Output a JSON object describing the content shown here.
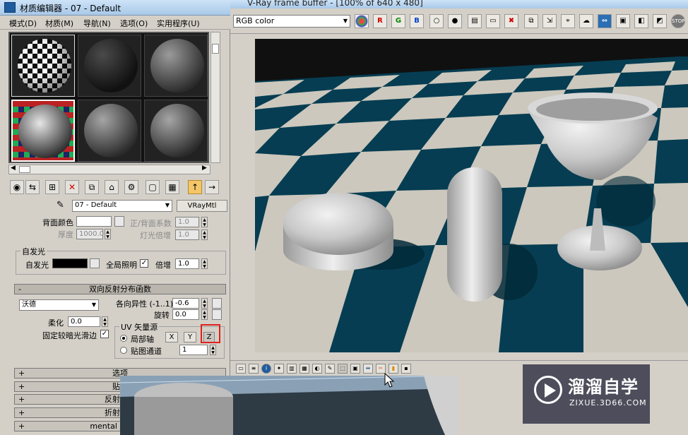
{
  "material_editor": {
    "title": "材质编辑器 - 07 - Default",
    "menu": [
      "模式(D)",
      "材质(M)",
      "导航(N)",
      "选项(O)",
      "实用程序(U)"
    ],
    "material_name": "07 - Default",
    "material_type": "VRayMtl",
    "back_color_label": "背面颜色",
    "front_back_coef_label": "正/背面系数",
    "front_back_coef": "1.0",
    "thickness_label": "厚度",
    "thickness": "1000.0",
    "light_mult_label": "灯光倍增",
    "light_mult": "1.0",
    "self_illum_group": "自发光",
    "self_illum_label": "自发光",
    "gi_label": "全局照明",
    "gi_checked": "✓",
    "multiplier_label": "倍增",
    "multiplier": "1.0",
    "brdf_title": "双向反射分布函数",
    "brdf_type": "沃德",
    "anisotropy_label": "各向异性 (-1..1)",
    "anisotropy": "-0.6",
    "rotation_label": "旋转",
    "rotation": "0.0",
    "soften_label": "柔化",
    "soften": "0.0",
    "fix_dark_label": "固定较暗光滑边",
    "fix_dark_checked": "✓",
    "uv_group": "UV 矢量源",
    "local_axis_label": "局部轴",
    "map_channel_label": "贴图通道",
    "map_channel": "1",
    "axis_x": "X",
    "axis_y": "Y",
    "axis_z": "Z",
    "rollouts": [
      "选项",
      "贴图",
      "反射插值",
      "折射插值",
      "mental ray 连接"
    ],
    "rollout_toggle": "+",
    "brdf_toggle": "-"
  },
  "frame_buffer": {
    "title": "V-Ray frame buffer - [100% of 640 x 480]",
    "channel": "RGB color",
    "toolbar_glyphs": [
      "R",
      "G",
      "B"
    ]
  },
  "watermark": {
    "brand": "溜溜自学",
    "url": "ZIXUE.3D66.COM"
  },
  "colors": {
    "highlight": "#e0201c",
    "render_floor_dark": "#063d52",
    "render_floor_light": "#ccc8bd"
  }
}
